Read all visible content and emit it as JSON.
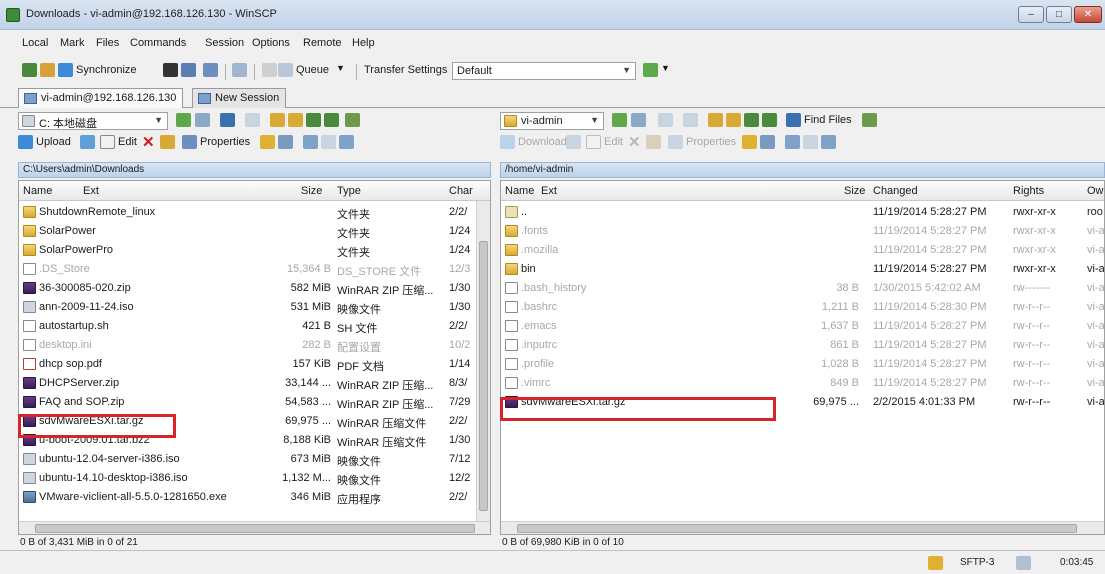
{
  "window": {
    "title": "Downloads - vi-admin@192.168.126.130 - WinSCP",
    "controls": [
      "–",
      "□",
      "✕"
    ]
  },
  "menu": [
    "Local",
    "Mark",
    "Files",
    "Commands",
    "Session",
    "Options",
    "Remote",
    "Help"
  ],
  "toolbar": {
    "synchronize": "Synchronize",
    "queue": "Queue",
    "transfer_settings_label": "Transfer Settings",
    "transfer_settings_value": "Default"
  },
  "tabs": [
    "vi-admin@192.168.126.130",
    "New Session"
  ],
  "left_panel": {
    "drive": "C: 本地磁盘",
    "upload": "Upload",
    "edit": "Edit",
    "properties": "Properties",
    "path": "C:\\Users\\admin\\Downloads",
    "columns": [
      "Name",
      "Ext",
      "Size",
      "Type",
      "Char"
    ],
    "files": [
      {
        "name": "ShutdownRemote_linux",
        "size": "",
        "type": "文件夹",
        "changed": "2/2/",
        "icon": "folder",
        "faded": false
      },
      {
        "name": "SolarPower",
        "size": "",
        "type": "文件夹",
        "changed": "1/24",
        "icon": "folder",
        "faded": false
      },
      {
        "name": "SolarPowerPro",
        "size": "",
        "type": "文件夹",
        "changed": "1/24",
        "icon": "folder",
        "faded": false
      },
      {
        "name": ".DS_Store",
        "size": "15,364 B",
        "type": "DS_STORE 文件",
        "changed": "12/3",
        "icon": "file",
        "faded": true
      },
      {
        "name": "36-300085-020.zip",
        "size": "582 MiB",
        "type": "WinRAR ZIP 压缩...",
        "changed": "1/30",
        "icon": "rar",
        "faded": false
      },
      {
        "name": "ann-2009-11-24.iso",
        "size": "531 MiB",
        "type": "映像文件",
        "changed": "1/30",
        "icon": "iso",
        "faded": false
      },
      {
        "name": "autostartup.sh",
        "size": "421 B",
        "type": "SH 文件",
        "changed": "2/2/",
        "icon": "file",
        "faded": false
      },
      {
        "name": "desktop.ini",
        "size": "282 B",
        "type": "配置设置",
        "changed": "10/2",
        "icon": "file",
        "faded": true
      },
      {
        "name": "dhcp sop.pdf",
        "size": "157 KiB",
        "type": "PDF 文档",
        "changed": "1/14",
        "icon": "pdf",
        "faded": false
      },
      {
        "name": "DHCPServer.zip",
        "size": "33,144 ...",
        "type": "WinRAR ZIP 压缩...",
        "changed": "8/3/",
        "icon": "rar",
        "faded": false
      },
      {
        "name": "FAQ and SOP.zip",
        "size": "54,583 ...",
        "type": "WinRAR ZIP 压缩...",
        "changed": "7/29",
        "icon": "rar",
        "faded": false
      },
      {
        "name": "sdvMwareESXi.tar.gz",
        "size": "69,975 ...",
        "type": "WinRAR 压缩文件",
        "changed": "2/2/",
        "icon": "rar",
        "faded": false
      },
      {
        "name": "u-boot-2009.01.tar.bz2",
        "size": "8,188 KiB",
        "type": "WinRAR 压缩文件",
        "changed": "1/30",
        "icon": "rar",
        "faded": false
      },
      {
        "name": "ubuntu-12.04-server-i386.iso",
        "size": "673 MiB",
        "type": "映像文件",
        "changed": "7/12",
        "icon": "iso",
        "faded": false
      },
      {
        "name": "ubuntu-14.10-desktop-i386.iso",
        "size": "1,132 M...",
        "type": "映像文件",
        "changed": "12/2",
        "icon": "iso",
        "faded": false
      },
      {
        "name": "VMware-viclient-all-5.5.0-1281650.exe",
        "size": "346 MiB",
        "type": "应用程序",
        "changed": "2/2/",
        "icon": "exe",
        "faded": false
      }
    ],
    "status": "0 B of 3,431 MiB in 0 of 21"
  },
  "right_panel": {
    "location": "vi-admin",
    "find_files": "Find Files",
    "download": "Download",
    "edit": "Edit",
    "properties": "Properties",
    "path": "/home/vi-admin",
    "columns": [
      "Name",
      "Ext",
      "Size",
      "Changed",
      "Rights",
      "Ow"
    ],
    "files": [
      {
        "name": "..",
        "size": "",
        "changed": "11/19/2014 5:28:27 PM",
        "rights": "rwxr-xr-x",
        "owner": "roo",
        "icon": "up",
        "faded": false
      },
      {
        "name": ".fonts",
        "size": "",
        "changed": "11/19/2014 5:28:27 PM",
        "rights": "rwxr-xr-x",
        "owner": "vi-a",
        "icon": "folder",
        "faded": true
      },
      {
        "name": ".mozilla",
        "size": "",
        "changed": "11/19/2014 5:28:27 PM",
        "rights": "rwxr-xr-x",
        "owner": "vi-a",
        "icon": "folder",
        "faded": true
      },
      {
        "name": "bin",
        "size": "",
        "changed": "11/19/2014 5:28:27 PM",
        "rights": "rwxr-xr-x",
        "owner": "vi-a",
        "icon": "folder",
        "faded": false
      },
      {
        "name": ".bash_history",
        "size": "38 B",
        "changed": "1/30/2015 5:42:02 AM",
        "rights": "rw-------",
        "owner": "vi-a",
        "icon": "file",
        "faded": true
      },
      {
        "name": ".bashrc",
        "size": "1,211 B",
        "changed": "11/19/2014 5:28:30 PM",
        "rights": "rw-r--r--",
        "owner": "vi-a",
        "icon": "file",
        "faded": true
      },
      {
        "name": ".emacs",
        "size": "1,637 B",
        "changed": "11/19/2014 5:28:27 PM",
        "rights": "rw-r--r--",
        "owner": "vi-a",
        "icon": "file",
        "faded": true
      },
      {
        "name": ".inputrc",
        "size": "861 B",
        "changed": "11/19/2014 5:28:27 PM",
        "rights": "rw-r--r--",
        "owner": "vi-a",
        "icon": "file",
        "faded": true
      },
      {
        "name": ".profile",
        "size": "1,028 B",
        "changed": "11/19/2014 5:28:27 PM",
        "rights": "rw-r--r--",
        "owner": "vi-a",
        "icon": "file",
        "faded": true
      },
      {
        "name": ".vimrc",
        "size": "849 B",
        "changed": "11/19/2014 5:28:27 PM",
        "rights": "rw-r--r--",
        "owner": "vi-a",
        "icon": "file",
        "faded": true
      },
      {
        "name": "sdvMwareESXi.tar.gz",
        "size": "69,975 ...",
        "changed": "2/2/2015 4:01:33 PM",
        "rights": "rw-r--r--",
        "owner": "vi-a",
        "icon": "rar",
        "faded": false
      }
    ],
    "status": "0 B of 69,980 KiB in 0 of 10"
  },
  "statusbar": {
    "protocol": "SFTP-3",
    "time": "0:03:45"
  },
  "colors": {
    "highlight": "#d8232a",
    "path_bar": "#bcd2ea",
    "title_bar": "#c2d3e8"
  }
}
